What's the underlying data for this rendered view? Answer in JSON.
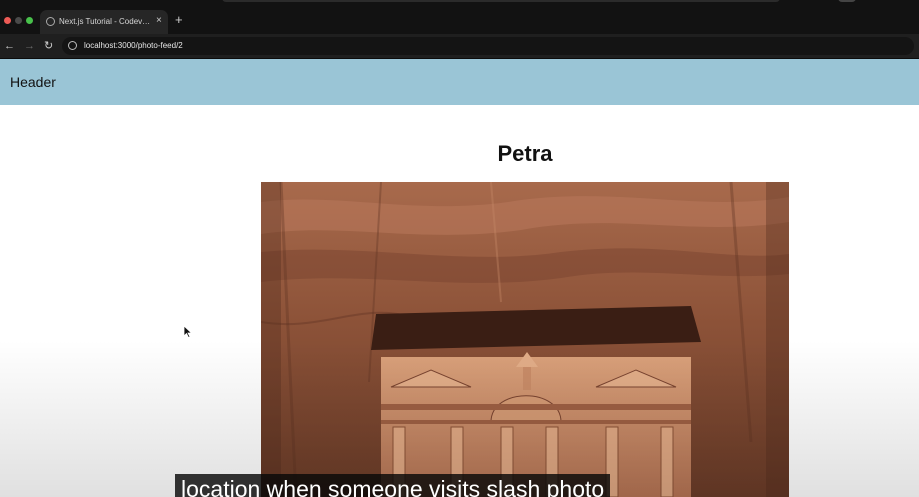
{
  "browser": {
    "tab": {
      "title": "Next.js Tutorial - Codevolution"
    },
    "new_tab_symbol": "+",
    "close_symbol": "×",
    "nav": {
      "back": "←",
      "forward": "→",
      "reload": "↻"
    },
    "url": "localhost:3000/photo-feed/2"
  },
  "page": {
    "header": {
      "text": "Header"
    },
    "photo": {
      "title": "Petra",
      "icon": "petra-treasury-photo"
    }
  },
  "overlay": {
    "caption": "location when someone visits slash photo"
  },
  "colors": {
    "header_bg": "#9ac5d6",
    "browser_bg": "#121212"
  }
}
